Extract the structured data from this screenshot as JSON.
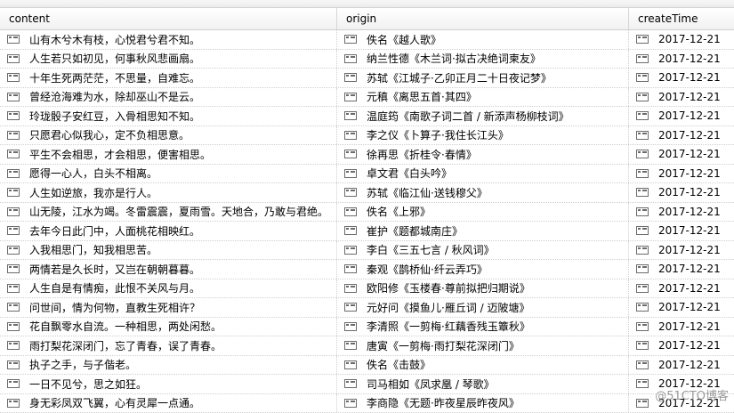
{
  "table": {
    "columns": [
      "content",
      "origin",
      "createTime"
    ],
    "rows": [
      {
        "content": "山有木兮木有枝，心悦君兮君不知。",
        "origin": "佚名《越人歌》",
        "createTime": "2017-12-21"
      },
      {
        "content": "人生若只如初见，何事秋风悲画扇。",
        "origin": "纳兰性德《木兰词·拟古决绝词柬友》",
        "createTime": "2017-12-21"
      },
      {
        "content": "十年生死两茫茫，不思量，自难忘。",
        "origin": "苏轼《江城子·乙卯正月二十日夜记梦》",
        "createTime": "2017-12-21"
      },
      {
        "content": "曾经沧海难为水，除却巫山不是云。",
        "origin": "元稹《离思五首·其四》",
        "createTime": "2017-12-21"
      },
      {
        "content": "玲珑骰子安红豆，入骨相思知不知。",
        "origin": "温庭筠《南歌子词二首 / 新添声杨柳枝词》",
        "createTime": "2017-12-21"
      },
      {
        "content": "只愿君心似我心，定不负相思意。",
        "origin": "李之仪《卜算子·我住长江头》",
        "createTime": "2017-12-21"
      },
      {
        "content": "平生不会相思，才会相思，便害相思。",
        "origin": "徐再思《折桂令·春情》",
        "createTime": "2017-12-21"
      },
      {
        "content": "愿得一心人，白头不相离。",
        "origin": "卓文君《白头吟》",
        "createTime": "2017-12-21"
      },
      {
        "content": "人生如逆旅，我亦是行人。",
        "origin": "苏轼《临江仙·送钱穆父》",
        "createTime": "2017-12-21"
      },
      {
        "content": "山无陵，江水为竭。冬雷震震，夏雨雪。天地合，乃敢与君绝。",
        "origin": "佚名《上邪》",
        "createTime": "2017-12-21"
      },
      {
        "content": "去年今日此门中，人面桃花相映红。",
        "origin": "崔护《题都城南庄》",
        "createTime": "2017-12-21"
      },
      {
        "content": "入我相思门，知我相思苦。",
        "origin": "李白《三五七言 / 秋风词》",
        "createTime": "2017-12-21"
      },
      {
        "content": "两情若是久长时，又岂在朝朝暮暮。",
        "origin": "秦观《鹊桥仙·纤云弄巧》",
        "createTime": "2017-12-21"
      },
      {
        "content": "人生自是有情痴，此恨不关风与月。",
        "origin": "欧阳修《玉楼春·尊前拟把归期说》",
        "createTime": "2017-12-21"
      },
      {
        "content": "问世间，情为何物，直教生死相许？",
        "origin": "元好问《摸鱼儿·雁丘词 / 迈陂塘》",
        "createTime": "2017-12-21"
      },
      {
        "content": "花自飘零水自流。一种相思，两处闲愁。",
        "origin": "李清照《一剪梅·红藕香残玉簟秋》",
        "createTime": "2017-12-21"
      },
      {
        "content": "雨打梨花深闭门，忘了青春，误了青春。",
        "origin": "唐寅《一剪梅·雨打梨花深闭门》",
        "createTime": "2017-12-21"
      },
      {
        "content": "执子之手，与子偕老。",
        "origin": "佚名《击鼓》",
        "createTime": "2017-12-21"
      },
      {
        "content": "一日不见兮，思之如狂。",
        "origin": "司马相如《凤求凰 / 琴歌》",
        "createTime": "2017-12-21"
      },
      {
        "content": "身无彩凤双飞翼，心有灵犀一点通。",
        "origin": "李商隐《无题·昨夜星辰昨夜风》",
        "createTime": "2017-12-21"
      }
    ]
  },
  "watermark": "@51CTO博客",
  "icons": {
    "cell": "text-field-icon"
  }
}
